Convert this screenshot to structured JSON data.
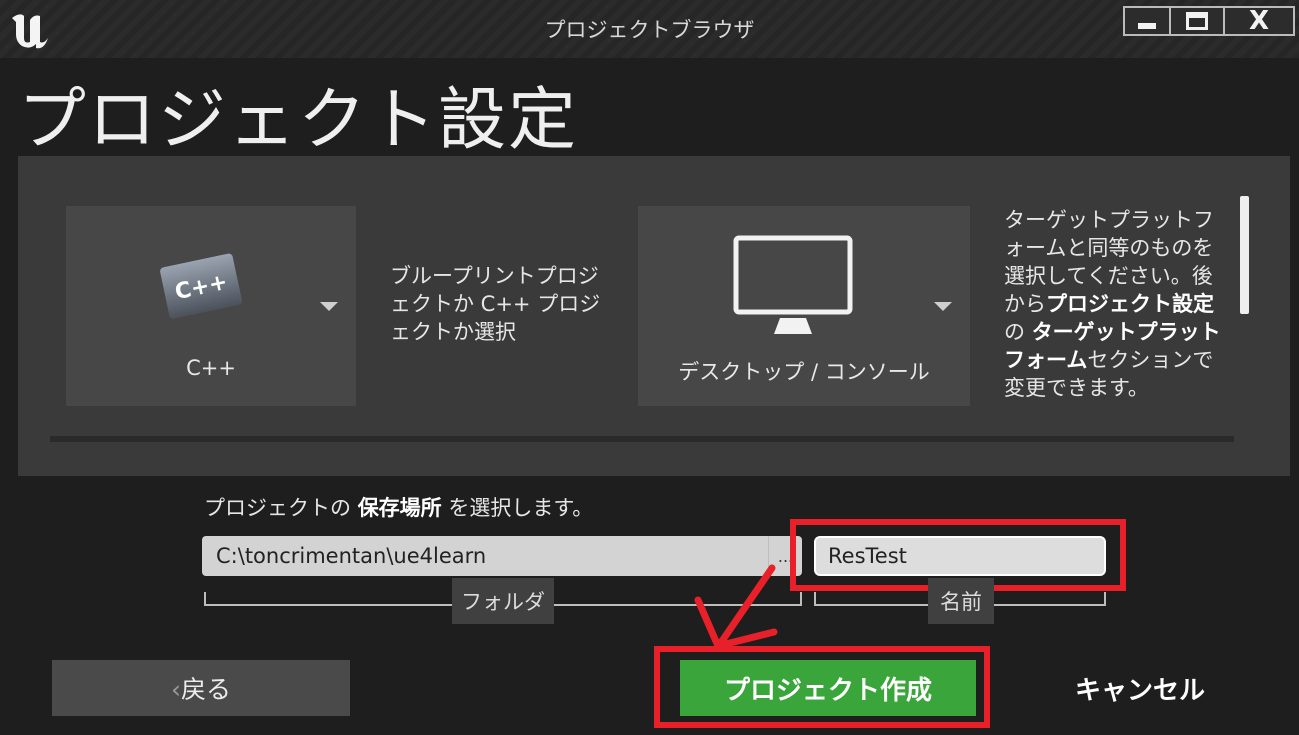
{
  "window": {
    "title": "プロジェクトブラウザ",
    "controls": [
      "minimize-icon",
      "maximize-icon",
      "close-icon"
    ],
    "close_glyph": "X"
  },
  "page": {
    "title": "プロジェクト設定"
  },
  "settings": {
    "project_type": {
      "icon": "cpp-file-icon",
      "icon_text": "C++",
      "label": "C++"
    },
    "project_type_description": "ブループリントプロジェクトか C++ プロジェクトか選択",
    "platform": {
      "icon": "monitor-icon",
      "label": "デスクトップ / コンソール"
    },
    "platform_description": {
      "part1": "ターゲットプラットフォームと同等のものを選択してください。後から",
      "bold1": "プロジェクト設定",
      "part2": "の ",
      "bold2": "ターゲットプラットフォーム",
      "part3": "セクションで変更できます。"
    }
  },
  "location": {
    "caption_prefix": "プロジェクトの ",
    "caption_bold": "保存場所",
    "caption_suffix": " を選択します。",
    "folder_path": "C:\\toncrimentan\\ue4learn",
    "browse_label": "...",
    "folder_label": "フォルダ",
    "project_name": "ResTest",
    "name_label": "名前"
  },
  "buttons": {
    "back_chevron": "‹",
    "back": "戻る",
    "create": "プロジェクト作成",
    "cancel": "キャンセル"
  },
  "colors": {
    "accent_green": "#3aa53a",
    "annotation_red": "#e8202a",
    "panel_bg": "#3a3a3a",
    "window_bg": "#1e1e1e"
  }
}
